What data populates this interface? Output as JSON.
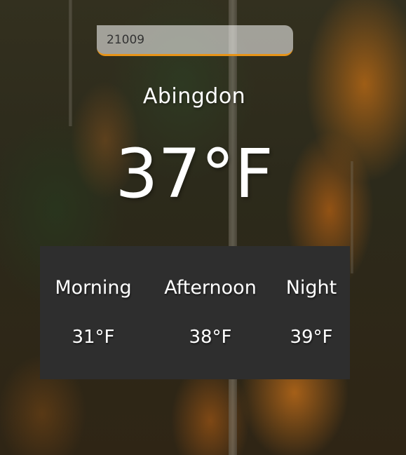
{
  "search": {
    "value": "21009",
    "accent_color": "#e69318"
  },
  "location": {
    "city": "Abingdon"
  },
  "current": {
    "temperature": "37°F"
  },
  "forecast": {
    "background_color": "#2e2e2e",
    "periods": [
      {
        "label": "Morning",
        "temperature": "31°F"
      },
      {
        "label": "Afternoon",
        "temperature": "38°F"
      },
      {
        "label": "Night",
        "temperature": "39°F"
      }
    ]
  }
}
